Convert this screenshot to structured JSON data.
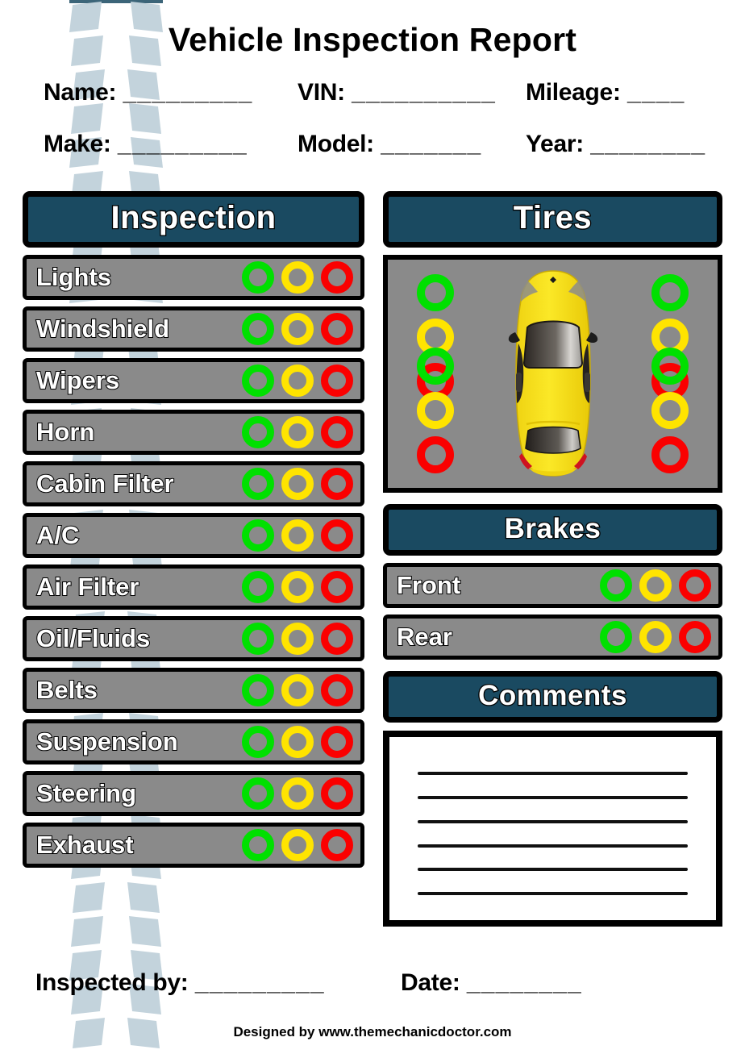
{
  "document": {
    "title": "Vehicle Inspection Report",
    "credit": "Designed by www.themechanicdoctor.com"
  },
  "theme": {
    "banner_color": "#1a4a61",
    "row_color": "#8a8a8a",
    "green": "#00e000",
    "yellow": "#ffe400",
    "red": "#fa0000",
    "tread_color": "#c3d3dc",
    "border_color": "#000000"
  },
  "header_fields": [
    {
      "label": "Name:",
      "value": "",
      "blank": "_________"
    },
    {
      "label": "VIN:",
      "value": "",
      "blank": "__________"
    },
    {
      "label": "Mileage:",
      "value": "",
      "blank": "____"
    },
    {
      "label": "Make:",
      "value": "",
      "blank": "_________"
    },
    {
      "label": "Model:",
      "value": "",
      "blank": "_______"
    },
    {
      "label": "Year:",
      "value": "",
      "blank": "________"
    }
  ],
  "sections": {
    "inspection": {
      "title": "Inspection",
      "items": [
        {
          "label": "Lights"
        },
        {
          "label": "Windshield"
        },
        {
          "label": "Wipers"
        },
        {
          "label": "Horn"
        },
        {
          "label": "Cabin Filter"
        },
        {
          "label": "A/C"
        },
        {
          "label": "Air Filter"
        },
        {
          "label": "Oil/Fluids"
        },
        {
          "label": "Belts"
        },
        {
          "label": "Suspension"
        },
        {
          "label": "Steering"
        },
        {
          "label": "Exhaust"
        }
      ]
    },
    "tires": {
      "title": "Tires",
      "positions": [
        {
          "name": "front-left"
        },
        {
          "name": "front-right"
        },
        {
          "name": "rear-left"
        },
        {
          "name": "rear-right"
        }
      ]
    },
    "brakes": {
      "title": "Brakes",
      "items": [
        {
          "label": "Front"
        },
        {
          "label": "Rear"
        }
      ]
    },
    "comments": {
      "title": "Comments",
      "value": "",
      "line_count": 6
    }
  },
  "rating_options": [
    {
      "name": "good",
      "color": "#00e000"
    },
    {
      "name": "caution",
      "color": "#ffe400"
    },
    {
      "name": "fail",
      "color": "#fa0000"
    }
  ],
  "footer_fields": [
    {
      "label": "Inspected by:",
      "value": "",
      "blank": "_________"
    },
    {
      "label": "Date:",
      "value": "",
      "blank": "________"
    }
  ]
}
